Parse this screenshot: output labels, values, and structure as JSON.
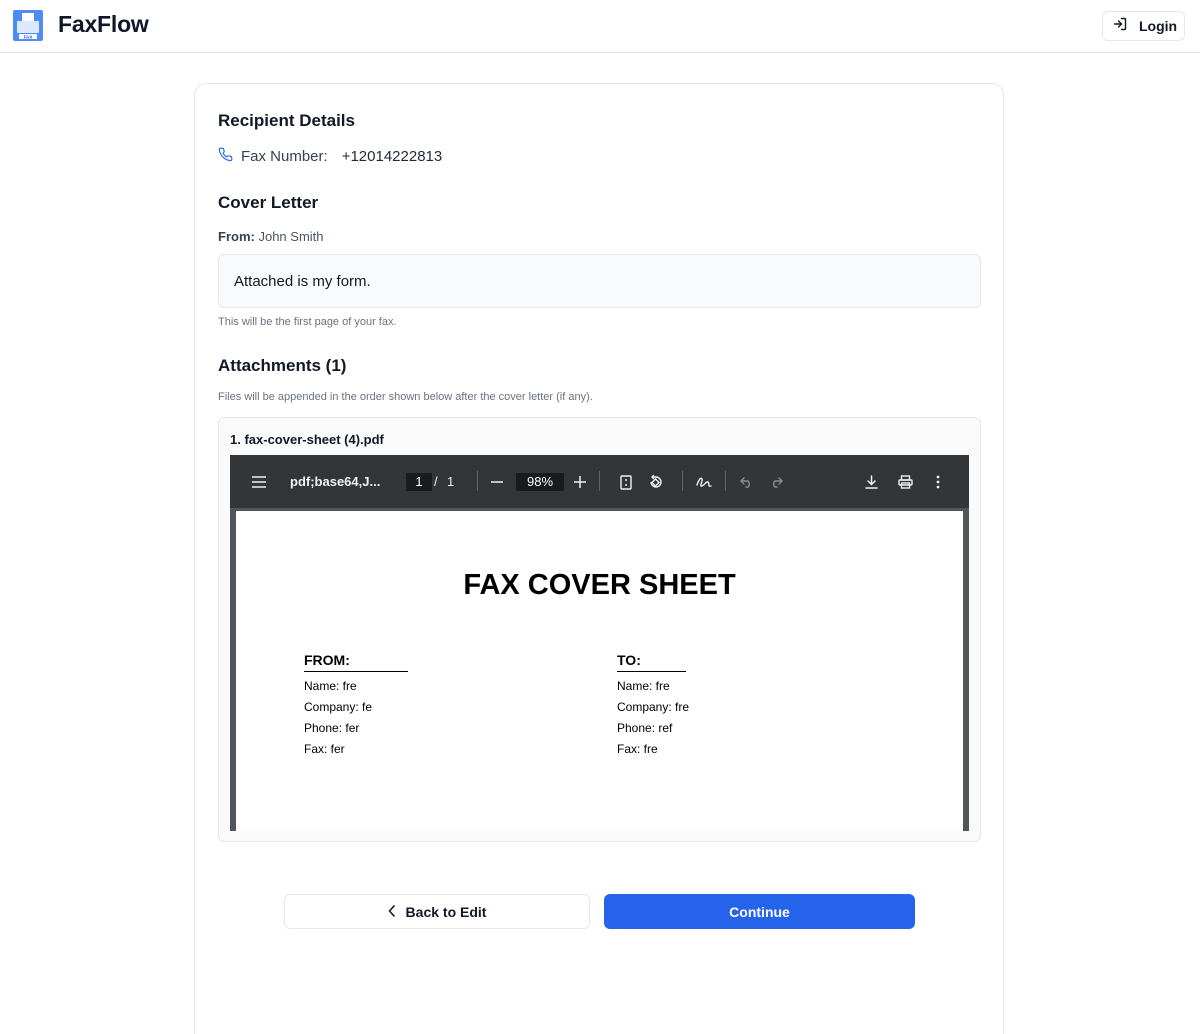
{
  "header": {
    "app_name": "FaxFlow",
    "logo_text": "FAX",
    "login_label": "Login"
  },
  "recipient": {
    "heading": "Recipient Details",
    "fax_label": "Fax Number:",
    "fax_number": "+12014222813"
  },
  "cover_letter": {
    "heading": "Cover Letter",
    "from_label": "From:",
    "from_name": "John Smith",
    "message": "Attached is my form.",
    "hint": "This will be the first page of your fax."
  },
  "attachments": {
    "heading": "Attachments (1)",
    "hint": "Files will be appended in the order shown below after the cover letter (if any).",
    "items": [
      {
        "name": "1. fax-cover-sheet (4).pdf"
      }
    ]
  },
  "pdf_viewer": {
    "title": "pdf;base64,J...",
    "current_page": "1",
    "page_separator": "/",
    "total_pages": "1",
    "zoom": "98%",
    "page": {
      "title": "FAX COVER SHEET",
      "from": {
        "heading": "FROM:",
        "lines": [
          "Name: fre",
          "Company: fe",
          "Phone: fer",
          "Fax: fer"
        ]
      },
      "to": {
        "heading": "TO:",
        "lines": [
          "Name: fre",
          "Company: fre",
          "Phone: ref",
          "Fax: fre"
        ]
      }
    }
  },
  "actions": {
    "back_label": "Back to Edit",
    "continue_label": "Continue"
  },
  "colors": {
    "accent": "#2563eb",
    "toolbar": "#323639"
  }
}
